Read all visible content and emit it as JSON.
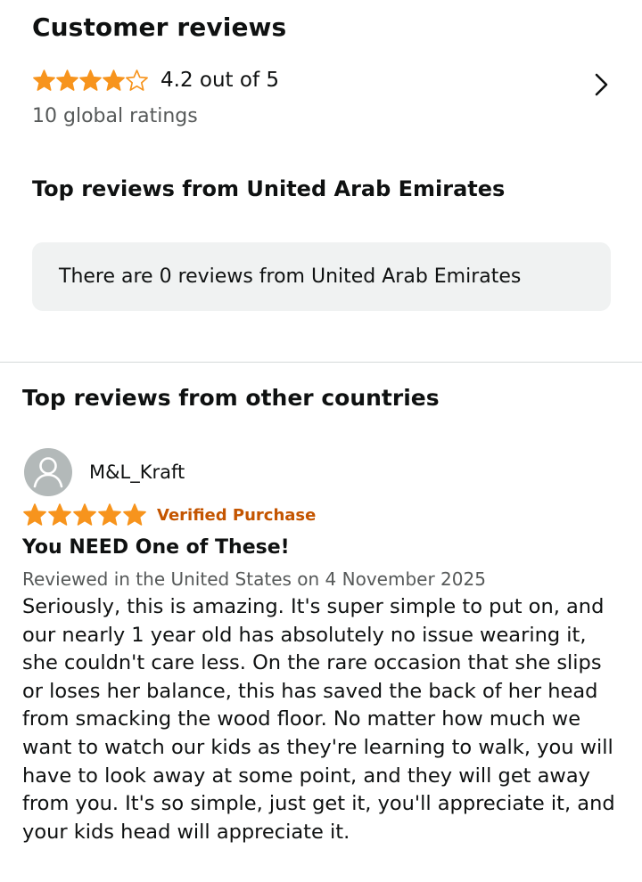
{
  "customer_reviews": {
    "title": "Customer reviews",
    "rating": 4.2,
    "rating_text": "4.2 out of 5",
    "global_ratings": "10 global ratings",
    "star_color": "#f7941d",
    "chevron_icon": "chevron-right-icon"
  },
  "uae_section": {
    "heading": "Top reviews from United Arab Emirates",
    "empty_message": "There are 0 reviews from United Arab Emirates"
  },
  "other_section": {
    "heading": "Top reviews from other countries",
    "reviews": [
      {
        "author": "M&L_Kraft",
        "avatar_icon": "user-avatar-icon",
        "stars": 5,
        "verified": "Verified Purchase",
        "verified_color": "#c45500",
        "title": "You NEED One of These!",
        "meta": "Reviewed in the United States on 4 November 2025",
        "body_lines": [
          "Seriously, this is amazing. It's super simple to put on, and",
          "our nearly 1 year old has absolutely no issue wearing it,",
          "she couldn't care less. On the rare occasion that she slips",
          "or loses her balance, this has saved the back of her head",
          "from smacking the wood floor. No matter how much we",
          "want to watch our kids as they're learning to walk, you will",
          "have to look away at some point, and they will get away",
          "from you. It's so simple, just get it, you'll appreciate it, and",
          "your kids head will appreciate it."
        ]
      }
    ]
  }
}
